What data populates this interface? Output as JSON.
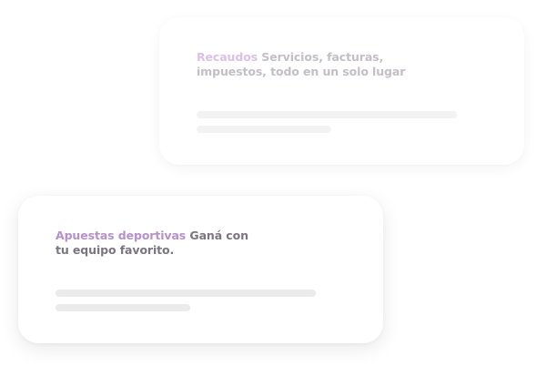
{
  "cards": [
    {
      "accent_label": "Recaudos",
      "description": "Servicios, facturas, impuestos, todo en un solo lugar"
    },
    {
      "accent_label": "Apuestas deportivas",
      "description": "Ganá con tu equipo favorito."
    }
  ],
  "colors": {
    "accent_light": "#d7b6e2",
    "accent": "#b78fce",
    "text_muted": "#b9b5bd",
    "text": "#7c7581",
    "placeholder_bar": "#ebebeb"
  }
}
